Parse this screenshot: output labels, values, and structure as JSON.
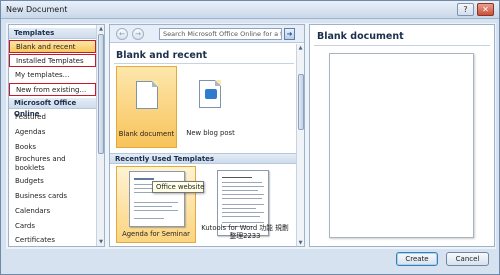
{
  "window": {
    "title": "New Document",
    "help_glyph": "?",
    "close_glyph": "✕"
  },
  "left_pane": {
    "templates_header": "Templates",
    "items": [
      {
        "label": "Blank and recent"
      },
      {
        "label": "Installed Templates"
      },
      {
        "label": "My templates..."
      },
      {
        "label": "New from existing..."
      }
    ],
    "office_online_header": "Microsoft Office Online",
    "online_items": [
      {
        "label": "Featured"
      },
      {
        "label": "Agendas"
      },
      {
        "label": "Books"
      },
      {
        "label": "Brochures and booklets"
      },
      {
        "label": "Budgets"
      },
      {
        "label": "Business cards"
      },
      {
        "label": "Calendars"
      },
      {
        "label": "Cards"
      },
      {
        "label": "Certificates"
      }
    ]
  },
  "middle_pane": {
    "back_glyph": "←",
    "forward_glyph": "→",
    "search_placeholder": "Search Microsoft Office Online for a t",
    "search_go_glyph": "➜",
    "heading": "Blank and recent",
    "tiles": [
      {
        "label": "Blank document"
      },
      {
        "label": "New blog post"
      }
    ],
    "recent_header": "Recently Used Templates",
    "recent": [
      {
        "label": "Agenda for Seminar"
      },
      {
        "label": "Kutools for Word 功能 規劃整理2233"
      }
    ],
    "tooltip": "Office website"
  },
  "right_pane": {
    "title": "Blank document"
  },
  "buttons": {
    "create": "Create",
    "cancel": "Cancel"
  },
  "colors": {
    "selected_highlight": "#f9c85e",
    "callout_border": "#c41b2a",
    "header_text": "#1b2f4d"
  }
}
